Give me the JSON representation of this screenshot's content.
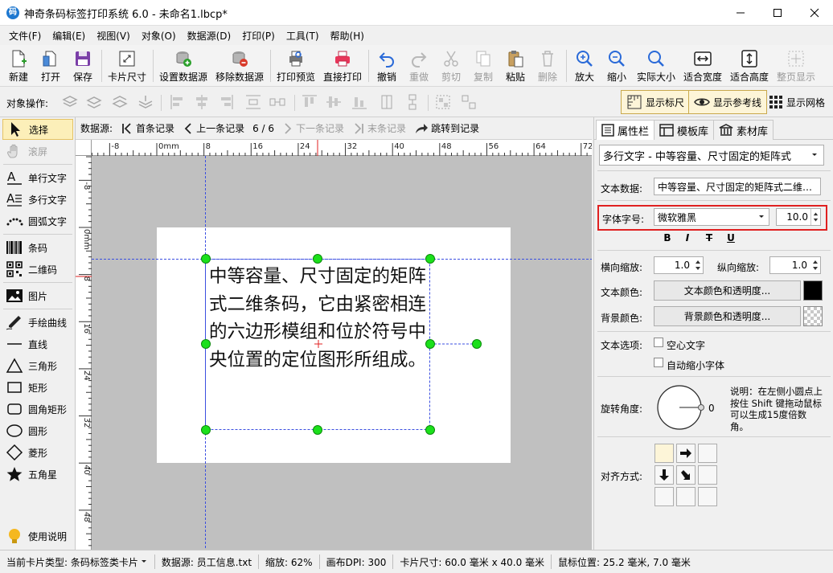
{
  "window": {
    "app_icon_glyph": "码",
    "title": "神奇条码标签打印系统 6.0 - 未命名1.lbcp*"
  },
  "menu": [
    "文件(F)",
    "编辑(E)",
    "视图(V)",
    "对象(O)",
    "数据源(D)",
    "打印(P)",
    "工具(T)",
    "帮助(H)"
  ],
  "toolbar": [
    {
      "id": "new",
      "label": "新建",
      "icon": "new-file-icon",
      "enabled": true
    },
    {
      "id": "open",
      "label": "打开",
      "icon": "open-file-icon",
      "enabled": true
    },
    {
      "id": "save",
      "label": "保存",
      "icon": "save-icon",
      "enabled": true
    },
    {
      "id": "card-size",
      "label": "卡片尺寸",
      "icon": "card-size-icon",
      "enabled": true
    },
    {
      "id": "set-datasource",
      "label": "设置数据源",
      "icon": "database-add-icon",
      "enabled": true
    },
    {
      "id": "remove-datasource",
      "label": "移除数据源",
      "icon": "database-remove-icon",
      "enabled": true
    },
    {
      "id": "print-preview",
      "label": "打印预览",
      "icon": "print-preview-icon",
      "enabled": true
    },
    {
      "id": "direct-print",
      "label": "直接打印",
      "icon": "printer-icon",
      "enabled": true
    },
    {
      "id": "undo",
      "label": "撤销",
      "icon": "undo-icon",
      "enabled": true
    },
    {
      "id": "redo",
      "label": "重做",
      "icon": "redo-icon",
      "enabled": false
    },
    {
      "id": "cut",
      "label": "剪切",
      "icon": "scissors-icon",
      "enabled": false
    },
    {
      "id": "copy",
      "label": "复制",
      "icon": "copy-icon",
      "enabled": false
    },
    {
      "id": "paste",
      "label": "粘贴",
      "icon": "paste-icon",
      "enabled": true
    },
    {
      "id": "delete",
      "label": "删除",
      "icon": "trash-icon",
      "enabled": false
    },
    {
      "id": "zoom-in",
      "label": "放大",
      "icon": "zoom-in-icon",
      "enabled": true
    },
    {
      "id": "zoom-out",
      "label": "缩小",
      "icon": "zoom-out-icon",
      "enabled": true
    },
    {
      "id": "actual-size",
      "label": "实际大小",
      "icon": "magnifier-icon",
      "enabled": true
    },
    {
      "id": "fit-width",
      "label": "适合宽度",
      "icon": "fit-width-icon",
      "enabled": true
    },
    {
      "id": "fit-height",
      "label": "适合高度",
      "icon": "fit-height-icon",
      "enabled": true
    },
    {
      "id": "fit-page",
      "label": "整页显示",
      "icon": "fit-page-icon",
      "enabled": false
    }
  ],
  "objbar": {
    "label": "对象操作:",
    "show_ruler": "显示标尺",
    "show_guides": "显示参考线",
    "show_grid": "显示网格"
  },
  "toolbox": [
    {
      "label": "选择",
      "icon": "pointer-icon",
      "selected": true,
      "enabled": true
    },
    {
      "label": "滚屏",
      "icon": "hand-icon",
      "selected": false,
      "enabled": false
    },
    {
      "label": "单行文字",
      "icon": "single-line-text-icon",
      "selected": false,
      "enabled": true
    },
    {
      "label": "多行文字",
      "icon": "multi-line-text-icon",
      "selected": false,
      "enabled": true
    },
    {
      "label": "圆弧文字",
      "icon": "arc-text-icon",
      "selected": false,
      "enabled": true
    },
    {
      "label": "条码",
      "icon": "barcode-icon",
      "selected": false,
      "enabled": true
    },
    {
      "label": "二维码",
      "icon": "qrcode-icon",
      "selected": false,
      "enabled": true
    },
    {
      "label": "图片",
      "icon": "image-icon",
      "selected": false,
      "enabled": true
    },
    {
      "label": "手绘曲线",
      "icon": "pen-icon",
      "selected": false,
      "enabled": true
    },
    {
      "label": "直线",
      "icon": "line-icon",
      "selected": false,
      "enabled": true
    },
    {
      "label": "三角形",
      "icon": "triangle-icon",
      "selected": false,
      "enabled": true
    },
    {
      "label": "矩形",
      "icon": "rectangle-icon",
      "selected": false,
      "enabled": true
    },
    {
      "label": "圆角矩形",
      "icon": "rounded-rectangle-icon",
      "selected": false,
      "enabled": true
    },
    {
      "label": "圆形",
      "icon": "circle-icon",
      "selected": false,
      "enabled": true
    },
    {
      "label": "菱形",
      "icon": "diamond-icon",
      "selected": false,
      "enabled": true
    },
    {
      "label": "五角星",
      "icon": "star-icon",
      "selected": false,
      "enabled": true
    },
    {
      "label": "使用说明",
      "icon": "lightbulb-icon",
      "selected": false,
      "enabled": true
    }
  ],
  "records": {
    "label": "数据源:",
    "first": "首条记录",
    "prev": "上一条记录",
    "counter": "6 / 6",
    "next": "下一条记录",
    "last": "末条记录",
    "jump": "跳转到记录"
  },
  "rulers": {
    "top_ticks": [
      "-8",
      "0mm",
      "8",
      "16",
      "24",
      "32",
      "40",
      "48",
      "56",
      "64",
      "72"
    ],
    "left_ticks": [
      "-8",
      "0mm",
      "8",
      "16",
      "24",
      "32",
      "40",
      "48"
    ]
  },
  "label": {
    "text": "中等容量、尺寸固定的矩阵式二维条码，它由紧密相连的六边形模组和位於符号中央位置的定位图形所组成。"
  },
  "panel": {
    "tabs": [
      {
        "label": "属性栏",
        "icon": "properties-icon",
        "active": true
      },
      {
        "label": "模板库",
        "icon": "template-icon",
        "active": false
      },
      {
        "label": "素材库",
        "icon": "library-icon",
        "active": false
      }
    ],
    "object_select": "多行文字 - 中等容量、尺寸固定的矩阵式",
    "text_data_label": "文本数据:",
    "text_data_value": "中等容量、尺寸固定的矩阵式二维条码，它由紧密相连的六边形模组和位於符号中央位置的定位图形所组成。",
    "font_label": "字体字号:",
    "font_name": "微软雅黑",
    "font_size": "10.0",
    "style_buttons": [
      "B",
      "I",
      "T",
      "U"
    ],
    "hscale_label": "横向缩放:",
    "hscale_value": "1.0",
    "vscale_label": "纵向缩放:",
    "vscale_value": "1.0",
    "text_color_label": "文本颜色:",
    "text_color_button": "文本颜色和透明度...",
    "text_color": "#000000",
    "bg_color_label": "背景颜色:",
    "bg_color_button": "背景颜色和透明度...",
    "text_options_label": "文本选项:",
    "hollow_text": "空心文字",
    "auto_shrink": "自动缩小字体",
    "rotation_label": "旋转角度:",
    "rotation_value": "0",
    "rotation_help": "说明：在左侧小圆点上按住 Shift 键拖动鼠标可以生成15度倍数角。",
    "align_label": "对齐方式:"
  },
  "status": {
    "card_type": "当前卡片类型: 条码标签类卡片",
    "datasource": "数据源: 员工信息.txt",
    "zoom": "缩放: 62%",
    "dpi": "画布DPI: 300",
    "card_size": "卡片尺寸: 60.0 毫米 x 40.0 毫米",
    "mouse_pos": "鼠标位置: 25.2 毫米, 7.0 毫米"
  },
  "colors": {
    "accent_green": "#1be01b",
    "guide_blue": "#3b4fe0",
    "highlight_red": "#e02020"
  }
}
